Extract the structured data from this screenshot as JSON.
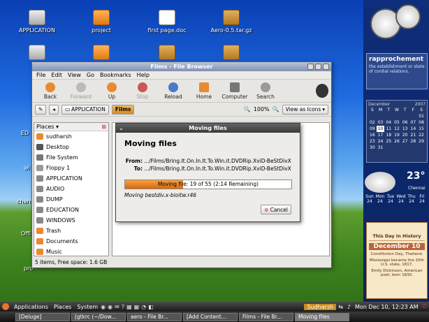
{
  "desktop": {
    "icons": [
      {
        "label": "APPLICATION",
        "type": "drive"
      },
      {
        "label": "project",
        "type": "folder"
      },
      {
        "label": "first page.doc",
        "type": "doc"
      },
      {
        "label": "Aero-0.5.tar.gz",
        "type": "box"
      }
    ],
    "partial_labels": [
      "ED",
      "wi",
      "chan",
      "Offi",
      "pro"
    ]
  },
  "file_browser": {
    "title": "Films - File Browser",
    "menu": [
      "File",
      "Edit",
      "View",
      "Go",
      "Bookmarks",
      "Help"
    ],
    "toolbar": {
      "back": "Back",
      "forward": "Forward",
      "up": "Up",
      "stop": "Stop",
      "reload": "Reload",
      "home": "Home",
      "computer": "Computer",
      "search": "Search"
    },
    "path": [
      "APPLICATION",
      "Films"
    ],
    "zoom": "100%",
    "view_as": "View as Icons",
    "places_label": "Places",
    "places": [
      "sudharsh",
      "Desktop",
      "File System",
      "Floppy 1",
      "APPLICATION",
      "AUDIO",
      "DUMP",
      "EDUCATION",
      "WINDOWS",
      "Trash",
      "Documents",
      "Music"
    ],
    "status": "5 items, Free space: 1.6 GB"
  },
  "dialog": {
    "title": "Moving files",
    "heading": "Moving files",
    "from_label": "From:",
    "from": ".../Films/Bring.It.On.In.It.To.Win.it.DVDRip.XviD-BeStDivX",
    "to_label": "To:",
    "to": ".../Films/Bring.It.On.In.It.To.Win.it.DVDRip.XviD-BeStDivX",
    "progress_text": "Moving file: 19 of 55 (2:14 Remaining)",
    "progress": 0.35,
    "current": "Moving  bestdiv.x-bioitw.r46",
    "cancel": "Cancel"
  },
  "widgets": {
    "rapp_title": "rapprochement",
    "rapp_def": "the establishment or state of cordial relations.",
    "cal_month": "December",
    "cal_year": "2007",
    "cal_days": [
      "S",
      "M",
      "T",
      "W",
      "T",
      "F",
      "S"
    ],
    "cal_weeks": [
      [
        "",
        "",
        "",
        "",
        "",
        "",
        "01"
      ],
      [
        "02",
        "03",
        "04",
        "05",
        "06",
        "07",
        "08"
      ],
      [
        "09",
        "10",
        "11",
        "12",
        "13",
        "14",
        "15"
      ],
      [
        "16",
        "17",
        "18",
        "19",
        "20",
        "21",
        "22"
      ],
      [
        "23",
        "24",
        "25",
        "26",
        "27",
        "28",
        "29"
      ],
      [
        "30",
        "31",
        "",
        "",
        "",
        "",
        ""
      ]
    ],
    "today": "10",
    "weather_temp": "23°",
    "weather_city": "Chennai",
    "forecast": [
      {
        "d": "Sun",
        "t": "24"
      },
      {
        "d": "Mon",
        "t": "24"
      },
      {
        "d": "Tue",
        "t": "24"
      },
      {
        "d": "Wed",
        "t": "24"
      },
      {
        "d": "Thu",
        "t": "24"
      },
      {
        "d": "Fri",
        "t": "24"
      }
    ],
    "hist_title": "This Day in History",
    "hist_date": "December 10",
    "hist_items": [
      "Constitution Day, Thailand.",
      "Mississippi became the 20th U.S. state, 1817.",
      "Emily Dickinson, American poet, born 1830."
    ]
  },
  "panel": {
    "menus": [
      "Applications",
      "Places",
      "System"
    ],
    "user": "Sudharsh",
    "clock": "Mon Dec 10, 12:23 AM",
    "tasks": [
      "[Deluge]",
      "[gtkrc (~/Dow...",
      "aero - File Br...",
      "[Add Content...",
      "Films - File Br...",
      "Moving files"
    ]
  },
  "colors": {
    "accent": "#d88a20",
    "title": "#8090b0",
    "dialog_title": "#3a3a3a"
  }
}
